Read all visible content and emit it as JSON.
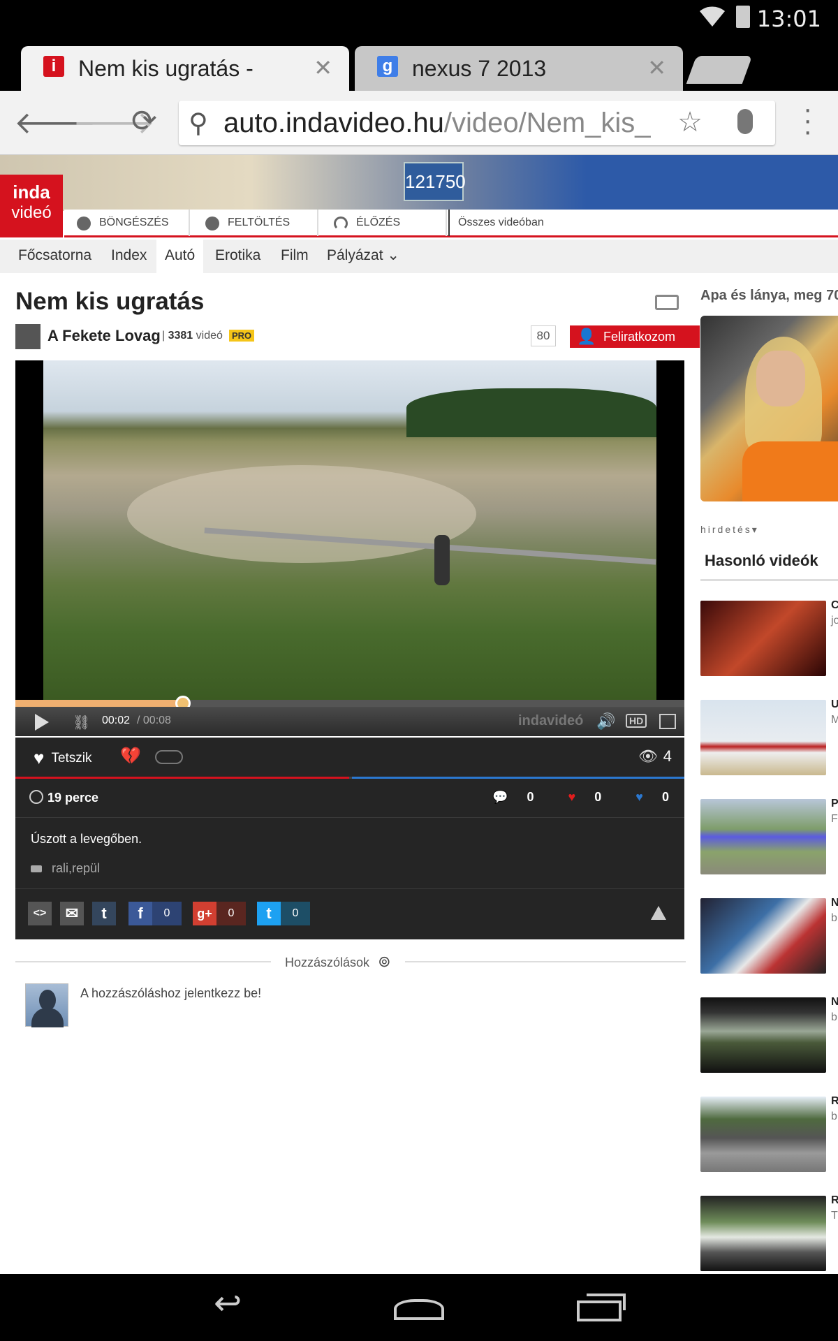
{
  "status_bar": {
    "time": "13:01"
  },
  "browser": {
    "tabs": [
      {
        "title": "Nem kis ugratás -",
        "favicon": "i",
        "favicon_color": "#d5121e"
      },
      {
        "title": "nexus 7 2013",
        "favicon": "g",
        "favicon_color": "#3f7ee8"
      }
    ],
    "close_glyph": "✕",
    "url_host": "auto.indavideo.hu",
    "url_path": "/video/Nem_kis_"
  },
  "site": {
    "logo_line1": "inda",
    "logo_line2": "videó",
    "header_plate": "121750",
    "nav": [
      {
        "label": "BÖNGÉSZÉS",
        "icon": "globe-icon"
      },
      {
        "label": "FELTÖLTÉS",
        "icon": "upload-icon"
      },
      {
        "label": "ÉLŐZÉS",
        "icon": "wifi-icon"
      }
    ],
    "search_label": "Összes videóban",
    "categories": [
      "Főcsatorna",
      "Index",
      "Autó",
      "Erotika",
      "Film",
      "Pályázat ⌄"
    ],
    "active_category": "Autó",
    "accent": "#d5121e"
  },
  "video": {
    "title": "Nem kis ugratás",
    "channel": "A Fekete Lovag",
    "separator": "|",
    "video_count": "3381",
    "video_count_label": "videó",
    "badge": "PRO",
    "subscriber_count": "80",
    "subscribe_label": "Feliratkozom",
    "current_time": "00:02",
    "duration": "/ 00:08",
    "progress_fraction": 0.25,
    "player_brand": "indavideó",
    "hd_label": "HD",
    "like_label": "Tetszik",
    "views": "4",
    "uploaded": "19 perce",
    "comments_count": "0",
    "loves_count": "0",
    "blue_hearts_count": "0",
    "description": "Úszott a levegőben.",
    "tags": "rali,repül",
    "share": [
      {
        "icon": "embed-icon",
        "glyph": "<>",
        "color": "#555"
      },
      {
        "icon": "email-icon",
        "glyph": "✉",
        "color": "#555"
      },
      {
        "icon": "tumblr-icon",
        "glyph": "t",
        "color": "#34465d"
      },
      {
        "icon": "facebook-icon",
        "glyph": "f",
        "color": "#3b5998",
        "count": "0"
      },
      {
        "icon": "googleplus-icon",
        "glyph": "g+",
        "color": "#d23f31",
        "count": "0"
      },
      {
        "icon": "twitter-icon",
        "glyph": "t",
        "color": "#1da1f2",
        "count": "0"
      }
    ]
  },
  "comments": {
    "title": "Hozzászólások",
    "login_prompt": "A hozzászóláshoz jelentkezz be!"
  },
  "sidebar": {
    "featured_title": "Apa és lánya, meg 70",
    "ad_label": "hirdetés▾",
    "similar_title": "Hasonló videók",
    "items": [
      {
        "initial": "C",
        "sub": "jo"
      },
      {
        "initial": "U",
        "sub": "M"
      },
      {
        "initial": "P",
        "sub": "F"
      },
      {
        "initial": "N",
        "sub": "b"
      },
      {
        "initial": "N",
        "sub": "b"
      },
      {
        "initial": "R",
        "sub": "b"
      },
      {
        "initial": "R",
        "sub": "T"
      }
    ]
  }
}
